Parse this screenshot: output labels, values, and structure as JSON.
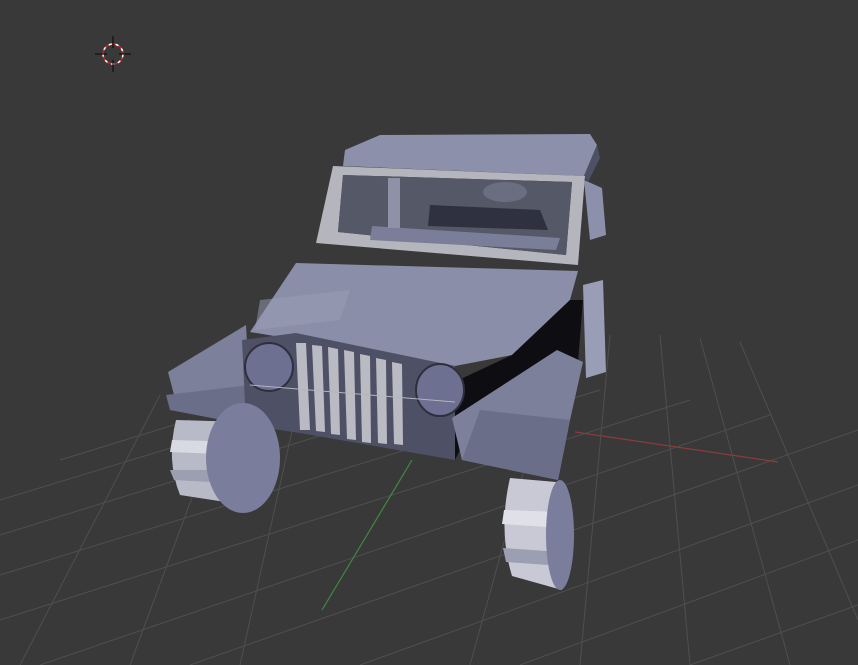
{
  "viewport": {
    "background": "#393939",
    "grid_color": "#4f4f4f",
    "x_axis_color": "#8a3c3c",
    "y_axis_color": "#3f8a3f"
  },
  "object": {
    "kind": "jeep",
    "body_color": "#7a7e98",
    "body_light": "#9a9db6",
    "body_dark": "#4e5166",
    "frame_color": "#b4b5bd"
  },
  "cursor": {
    "icon": "3d-cursor-icon",
    "ring_color": "#cc2222"
  }
}
